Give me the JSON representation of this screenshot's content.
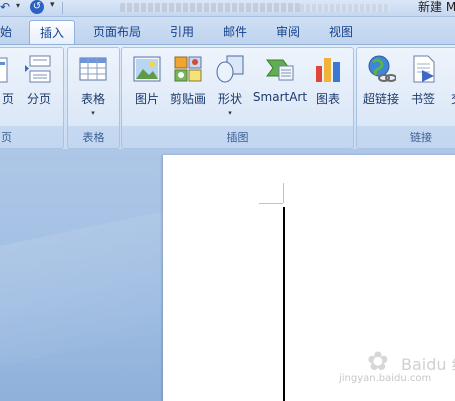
{
  "titlebar": {
    "undo_icon": "undo-icon",
    "redo_icon": "redo-icon",
    "redo_glyph": "↺",
    "doc_title": "新建 M"
  },
  "tabs": [
    {
      "label": "始"
    },
    {
      "label": "插入"
    },
    {
      "label": "页面布局"
    },
    {
      "label": "引用"
    },
    {
      "label": "邮件"
    },
    {
      "label": "审阅"
    },
    {
      "label": "视图"
    }
  ],
  "ribbon": {
    "groups": {
      "pages": {
        "label": "页"
      },
      "tables": {
        "label": "表格"
      },
      "illustrations": {
        "label": "插图"
      },
      "links": {
        "label": "链接"
      }
    },
    "buttons": {
      "cover_page": {
        "label": "页"
      },
      "page_break": {
        "label": "分页"
      },
      "table": {
        "label": "表格"
      },
      "picture": {
        "label": "图片"
      },
      "clip_art": {
        "label": "剪贴画"
      },
      "shapes": {
        "label": "形状"
      },
      "smartart": {
        "label": "SmartArt"
      },
      "chart": {
        "label": "图表"
      },
      "hyperlink": {
        "label": "超链接"
      },
      "bookmark": {
        "label": "书签"
      },
      "cross_ref": {
        "label": "交"
      }
    },
    "dropdown_glyph": "▾"
  },
  "watermark": {
    "brand": "Baidu 经验",
    "url": "jingyan.baidu.com"
  }
}
